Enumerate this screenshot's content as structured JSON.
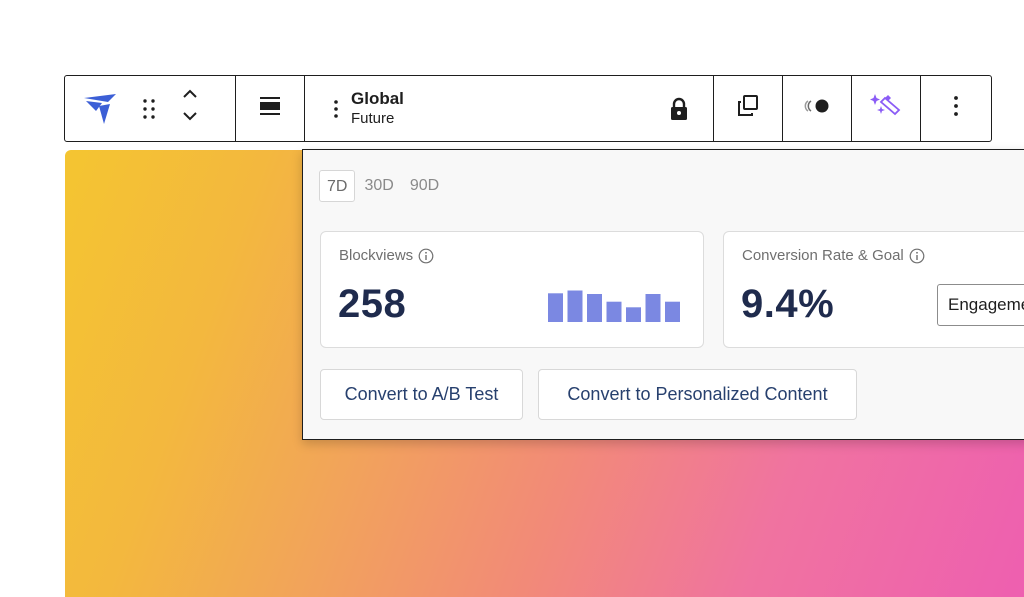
{
  "toolbar": {
    "block_title": "Global",
    "block_subtitle": "Future"
  },
  "popover": {
    "ranges": [
      "7D",
      "30D",
      "90D"
    ],
    "selected_range": "7D",
    "blockviews": {
      "label": "Blockviews",
      "value": "258",
      "trend": [
        0.82,
        0.9,
        0.8,
        0.58,
        0.42,
        0.8,
        0.58
      ],
      "bar_color": "#7b88e2"
    },
    "conversion": {
      "label": "Conversion Rate & Goal",
      "value": "9.4%",
      "goal_selected": "Engagement"
    },
    "actions": {
      "ab_test": "Convert to A/B Test",
      "personalized": "Convert to Personalized Content"
    }
  },
  "colors": {
    "logo": "#3c5fd6",
    "metric_text": "#1f2b4d",
    "action_text": "#27406e",
    "ai_icon": "#8b5cf6"
  },
  "icons": [
    "logo-icon",
    "drag-handle-icon",
    "chevron-up-icon",
    "chevron-down-icon",
    "align-icon",
    "more-vertical-icon",
    "lock-icon",
    "duplicate-icon",
    "toggle-icon",
    "ai-sparkle-icon",
    "info-icon"
  ]
}
